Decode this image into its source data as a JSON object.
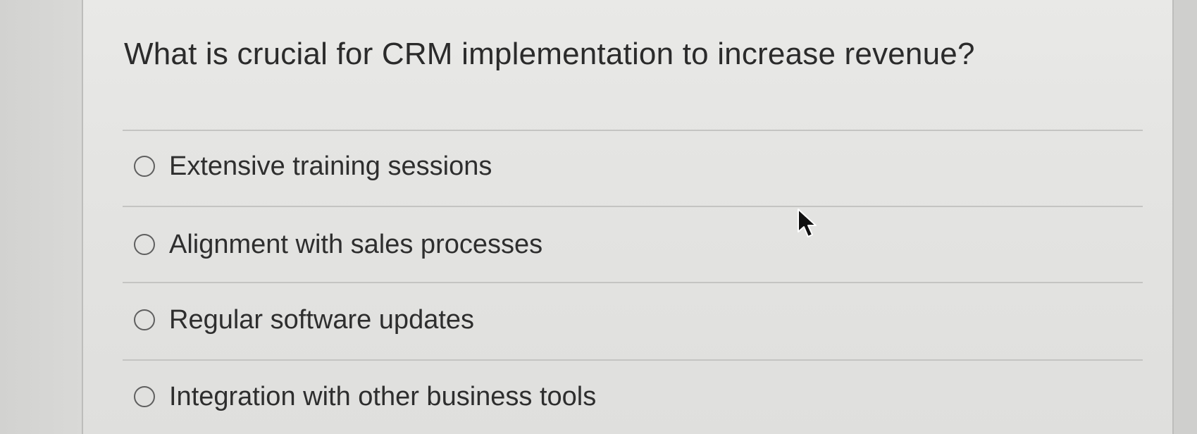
{
  "quiz": {
    "question": "What is crucial for CRM implementation to increase revenue?",
    "options": [
      {
        "label": "Extensive training sessions",
        "selected": false
      },
      {
        "label": "Alignment with sales processes",
        "selected": false
      },
      {
        "label": "Regular software updates",
        "selected": false
      },
      {
        "label": "Integration with other business tools",
        "selected": false
      }
    ]
  },
  "icons": {
    "cursor": "arrow-cursor-icon"
  },
  "colors": {
    "text": "#2b2b2b",
    "radio_border": "#5f5f5f",
    "divider": "#c4c4c2"
  }
}
